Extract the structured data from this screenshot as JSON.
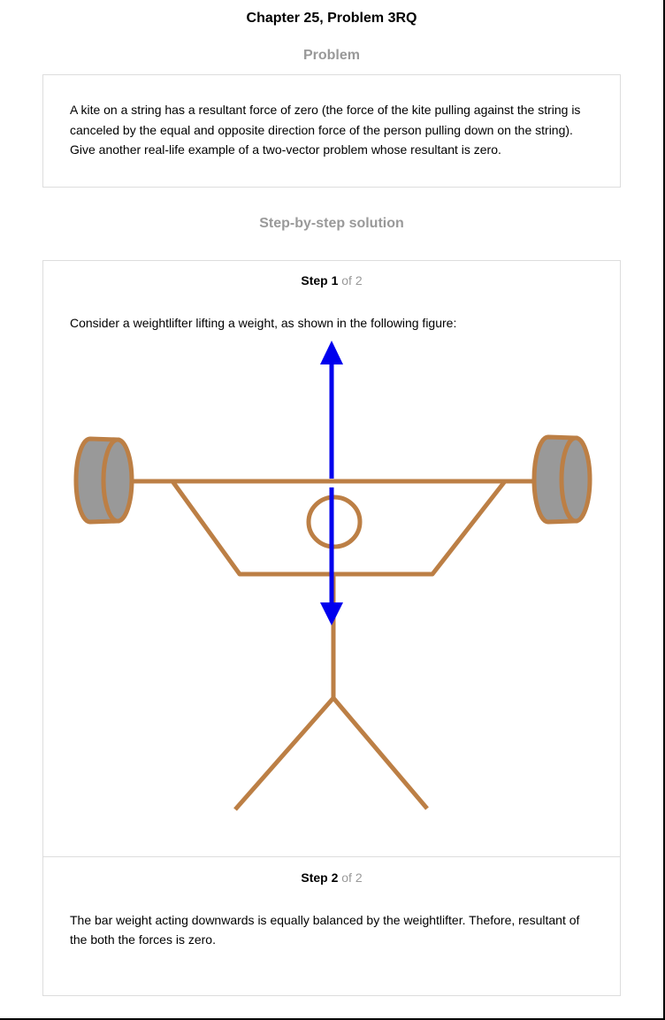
{
  "header": {
    "title": "Chapter 25, Problem 3RQ"
  },
  "problem": {
    "heading": "Problem",
    "text": "A kite on a string has a resultant force of zero (the force of the kite pulling against the string is canceled by the equal and opposite direction force of the person pulling down on the string). Give another real-life example of a two-vector problem whose resultant is zero."
  },
  "solution": {
    "heading": "Step-by-step solution",
    "steps": [
      {
        "step_word": "Step 1",
        "of_text": "of 2",
        "text": "Consider a weightlifter lifting a weight, as shown in the following figure:"
      },
      {
        "step_word": "Step 2",
        "of_text": "of 2",
        "text": "The bar weight acting downwards is equally balanced by the weightlifter. Thefore, resultant of the both the forces is zero."
      }
    ]
  },
  "figure": {
    "colors": {
      "figure_stroke": "#bc7f45",
      "plate_fill": "#999999",
      "vector_arrow": "#0000ee"
    }
  }
}
